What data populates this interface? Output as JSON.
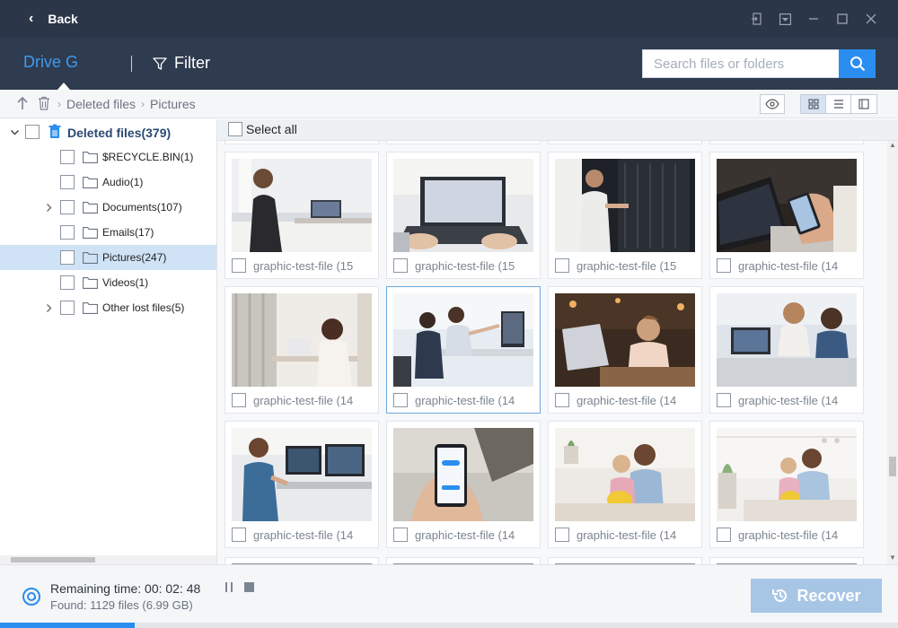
{
  "titlebar": {
    "back_label": "Back"
  },
  "toolbar": {
    "drive_label": "Drive G",
    "filter_label": "Filter",
    "search_placeholder": "Search files or folders"
  },
  "breadcrumb": {
    "items": [
      "Deleted files",
      "Pictures"
    ]
  },
  "sidebar": {
    "root": {
      "label": "Deleted files(379)",
      "expanded": true
    },
    "items": [
      {
        "label": "$RECYCLE.BIN(1)",
        "expandable": false
      },
      {
        "label": "Audio(1)",
        "expandable": false
      },
      {
        "label": "Documents(107)",
        "expandable": true
      },
      {
        "label": "Emails(17)",
        "expandable": false
      },
      {
        "label": "Pictures(247)",
        "expandable": false,
        "selected": true
      },
      {
        "label": "Videos(1)",
        "expandable": false
      },
      {
        "label": "Other lost files(5)",
        "expandable": true
      }
    ]
  },
  "main": {
    "select_all_label": "Select all",
    "files": [
      {
        "name": "graphic-test-file (15",
        "scene": "woman-laptop"
      },
      {
        "name": "graphic-test-file (15",
        "scene": "laptop-hands"
      },
      {
        "name": "graphic-test-file (15",
        "scene": "server-room"
      },
      {
        "name": "graphic-test-file (14",
        "scene": "phone-laptop"
      },
      {
        "name": "graphic-test-file (14",
        "scene": "woman-window"
      },
      {
        "name": "graphic-test-file (14",
        "scene": "office-monitor"
      },
      {
        "name": "graphic-test-file (14",
        "scene": "woman-cafe"
      },
      {
        "name": "graphic-test-file (14",
        "scene": "couple-computer"
      },
      {
        "name": "graphic-test-file (14",
        "scene": "man-monitors"
      },
      {
        "name": "graphic-test-file (14",
        "scene": "phone-app"
      },
      {
        "name": "graphic-test-file (14",
        "scene": "mother-daughter-flowers"
      },
      {
        "name": "graphic-test-file (14",
        "scene": "mother-daughter-room"
      }
    ],
    "focused_index": 5
  },
  "footer": {
    "remaining": "Remaining time: 00: 02: 48",
    "found": "Found: 1129 files (6.99 GB)",
    "recover_label": "Recover",
    "progress": 0.15
  },
  "colors": {
    "titlebar": "#2b3648",
    "toolbar": "#2f3b4f",
    "accent": "#2a8df0",
    "drive_tab": "#3b9bf0",
    "recover_disabled": "#a7c6e6",
    "selected_row": "#cfe2f6"
  },
  "icons": [
    "back-chevron-icon",
    "filter-icon",
    "search-icon",
    "up-arrow-icon",
    "recycle-bin-icon",
    "eye-icon",
    "grid-view-icon",
    "list-view-icon",
    "preview-pane-icon",
    "folder-icon",
    "pause-icon",
    "stop-icon",
    "scan-icon",
    "restore-icon"
  ]
}
